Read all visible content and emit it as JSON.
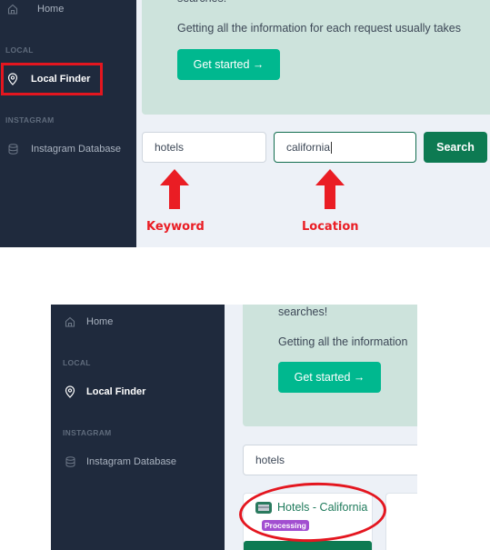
{
  "top_panel": {
    "sidebar": {
      "items": [
        {
          "label": "Home",
          "icon": "home-icon"
        },
        {
          "label": "Local Finder",
          "icon": "map-pin-icon",
          "active": true
        },
        {
          "label": "Instagram Database",
          "icon": "database-icon"
        }
      ],
      "sections": [
        "LOCAL",
        "INSTAGRAM"
      ]
    },
    "banner": {
      "line_partial": "searches!",
      "line2": "Getting all the information for each request usually takes",
      "button": "Get started →"
    },
    "search": {
      "keyword_value": "hotels",
      "location_value": "california",
      "button": "Search"
    },
    "annotations": {
      "keyword": "Keyword",
      "location": "Location"
    }
  },
  "bottom_panel": {
    "sidebar": {
      "items": [
        {
          "label": "Home",
          "icon": "home-icon"
        },
        {
          "label": "Local Finder",
          "icon": "map-pin-icon",
          "active": true
        },
        {
          "label": "Instagram Database",
          "icon": "database-icon"
        }
      ],
      "sections": [
        "LOCAL",
        "INSTAGRAM"
      ]
    },
    "banner": {
      "line1": "searches!",
      "line2": "Getting all the information",
      "button": "Get started →"
    },
    "search": {
      "keyword_value": "hotels"
    },
    "result_card": {
      "title": "Hotels - California",
      "status": "Processing"
    }
  },
  "colors": {
    "sidebar_bg": "#1f2a3d",
    "accent": "#00b88f",
    "primary_button": "#0d7a52",
    "banner_bg": "#cde3dc",
    "status_processing": "#a24fd0",
    "annotation_red": "#e4161f"
  }
}
